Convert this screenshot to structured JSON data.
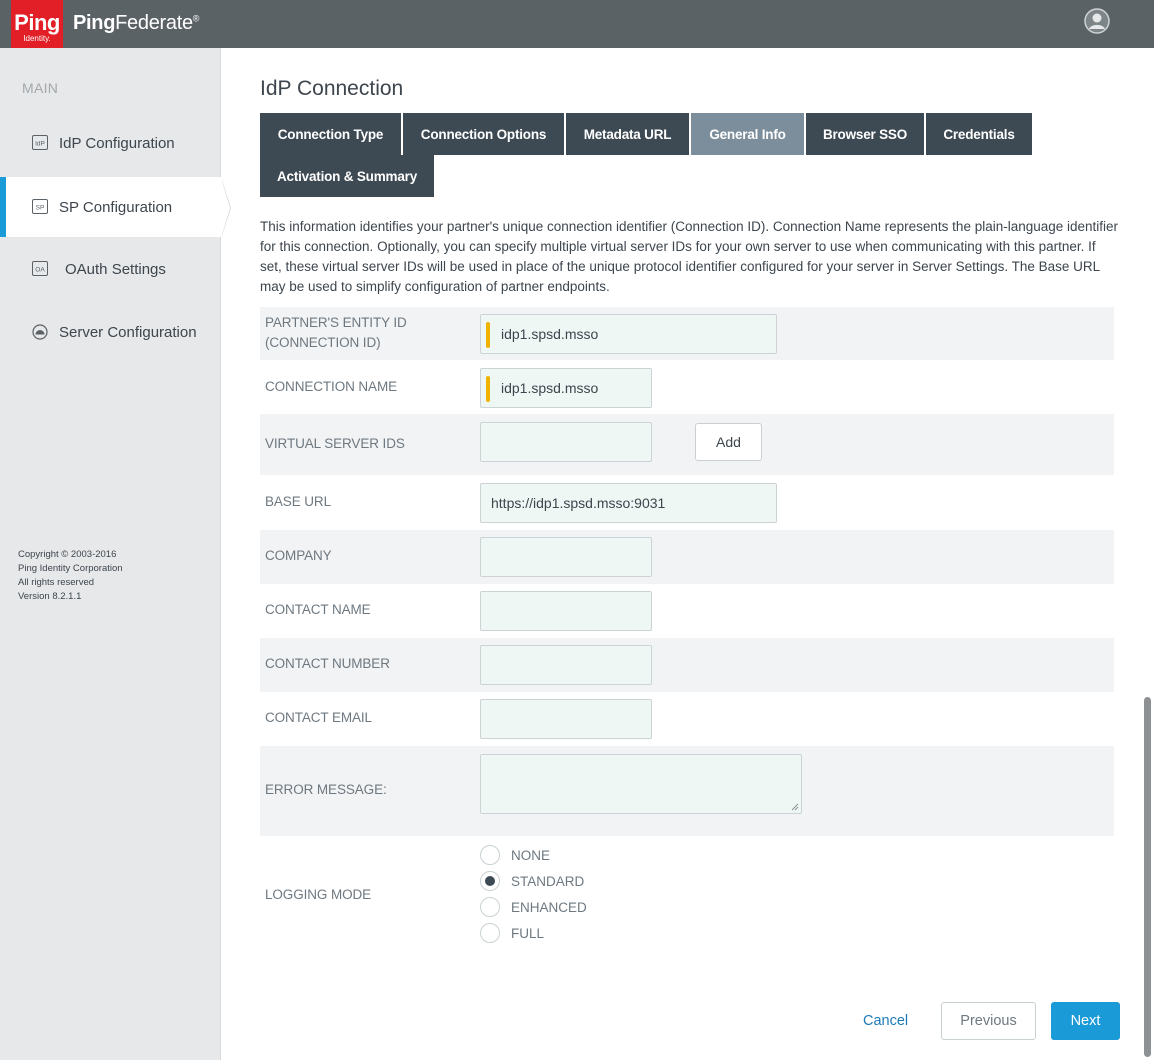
{
  "header": {
    "logo_text": "Ping",
    "logo_subtext": "Identity.",
    "product_name_bold": "Ping",
    "product_name_rest": "Federate",
    "product_trademark": "®",
    "user_icon": "user-avatar-icon"
  },
  "sidebar": {
    "heading": "MAIN",
    "items": [
      {
        "label": "IdP Configuration",
        "icon_text": "IdP",
        "icon": "idp-icon"
      },
      {
        "label": "SP Configuration",
        "icon_text": "SP",
        "icon": "sp-icon"
      },
      {
        "label": "OAuth Settings",
        "icon_text": "OA",
        "icon": "oauth-icon"
      },
      {
        "label": "Server Configuration",
        "icon": "server-icon"
      }
    ],
    "active_item": "SP Configuration",
    "copyright": [
      "Copyright © 2003-2016",
      "Ping Identity Corporation",
      "All rights reserved",
      "Version 8.2.1.1"
    ]
  },
  "main": {
    "title": "IdP Connection",
    "tabs": [
      {
        "label": "Connection Type"
      },
      {
        "label": "Connection Options"
      },
      {
        "label": "Metadata URL"
      },
      {
        "label": "General Info"
      },
      {
        "label": "Browser SSO"
      },
      {
        "label": "Credentials"
      },
      {
        "label": "Activation & Summary"
      }
    ],
    "selected_tab": "General Info",
    "description": "This information identifies your partner's unique connection identifier (Connection ID). Connection Name represents the plain-language identifier for this connection. Optionally, you can specify multiple virtual server IDs for your own server to use when communicating with this partner. If set, these virtual server IDs will be used in place of the unique protocol identifier configured for your server in Server Settings. The Base URL may be used to simplify configuration of partner endpoints.",
    "fields": {
      "entity_id": {
        "label_line1": "PARTNER'S ENTITY ID",
        "label_line2": "(CONNECTION ID)",
        "value": "idp1.spsd.msso"
      },
      "connection_name": {
        "label": "CONNECTION NAME",
        "value": "idp1.spsd.msso"
      },
      "virtual_server_ids": {
        "label": "VIRTUAL SERVER IDS",
        "value": "",
        "add_label": "Add"
      },
      "base_url": {
        "label": "BASE URL",
        "value": "https://idp1.spsd.msso:9031"
      },
      "company": {
        "label": "COMPANY",
        "value": ""
      },
      "contact_name": {
        "label": "CONTACT NAME",
        "value": ""
      },
      "contact_number": {
        "label": "CONTACT NUMBER",
        "value": ""
      },
      "contact_email": {
        "label": "CONTACT EMAIL",
        "value": ""
      },
      "error_message": {
        "label": "ERROR MESSAGE:",
        "value": ""
      }
    },
    "logging_mode": {
      "label": "LOGGING MODE",
      "options": [
        "NONE",
        "STANDARD",
        "ENHANCED",
        "FULL"
      ],
      "selected": "STANDARD"
    }
  },
  "footer": {
    "cancel_label": "Cancel",
    "previous_label": "Previous",
    "next_label": "Next"
  },
  "colors": {
    "topbar": "#5b6266",
    "logo_red": "#e21e26",
    "tab_bg": "#3e4a53",
    "tab_selected": "#7c8e9c",
    "accent_blue": "#1b9ad8",
    "required_marker": "#f0b400"
  }
}
